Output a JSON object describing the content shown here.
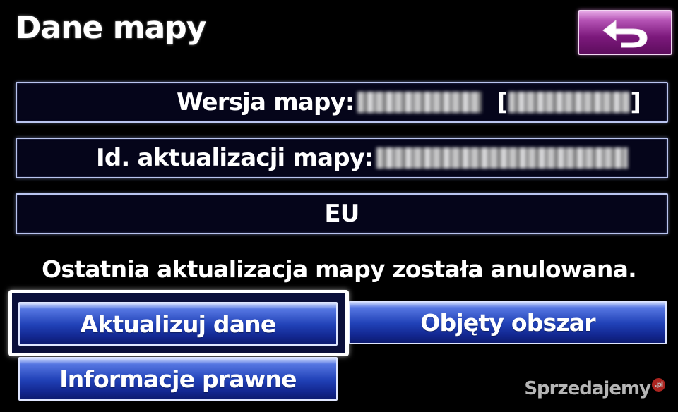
{
  "screen": {
    "title": "Dane mapy"
  },
  "back_button": {
    "icon": "back-arrow-icon",
    "color": "#8b2a8b"
  },
  "info": {
    "map_version_label": "Wersja mapy:",
    "map_update_id_label": "Id. aktualizacji mapy:",
    "region": "EU"
  },
  "status_message": "Ostatnia aktualizacja mapy została anulowana.",
  "buttons": {
    "update_data": "Aktualizuj dane",
    "covered_area": "Objęty obszar",
    "legal_info": "Informacje prawne"
  },
  "colors": {
    "button_blue": "#2142b8",
    "box_border": "#b9c4ef",
    "background": "#000000"
  },
  "watermark": {
    "text": "Sprzedajemy",
    "badge": ".pl"
  }
}
